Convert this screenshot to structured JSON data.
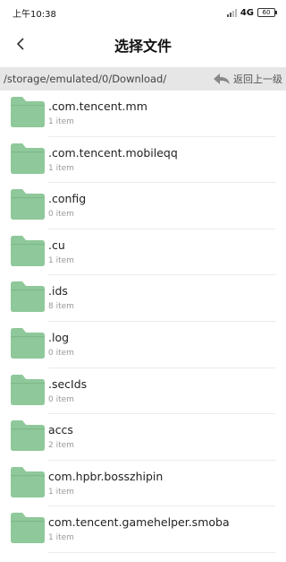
{
  "status_bar": {
    "time": "上午10:38",
    "network": "4G",
    "battery": "60"
  },
  "header": {
    "title": "选择文件",
    "back_icon": "chevron-left-icon"
  },
  "path_bar": {
    "path": "/storage/emulated/0/Download/",
    "up_label": "返回上一级",
    "up_icon": "undo-arrow-icon"
  },
  "colors": {
    "folder": "#8fc89a",
    "path_bar_bg": "#e6e6e6"
  },
  "files": [
    {
      "name": ".com.tencent.mm",
      "count": "1 item"
    },
    {
      "name": ".com.tencent.mobileqq",
      "count": "1 item"
    },
    {
      "name": ".config",
      "count": "0 item"
    },
    {
      "name": ".cu",
      "count": "1 item"
    },
    {
      "name": ".ids",
      "count": "8 item"
    },
    {
      "name": ".log",
      "count": "0 item"
    },
    {
      "name": ".secIds",
      "count": "0 item"
    },
    {
      "name": "accs",
      "count": "2 item"
    },
    {
      "name": "com.hpbr.bosszhipin",
      "count": "1 item"
    },
    {
      "name": "com.tencent.gamehelper.smoba",
      "count": "1 item"
    }
  ]
}
